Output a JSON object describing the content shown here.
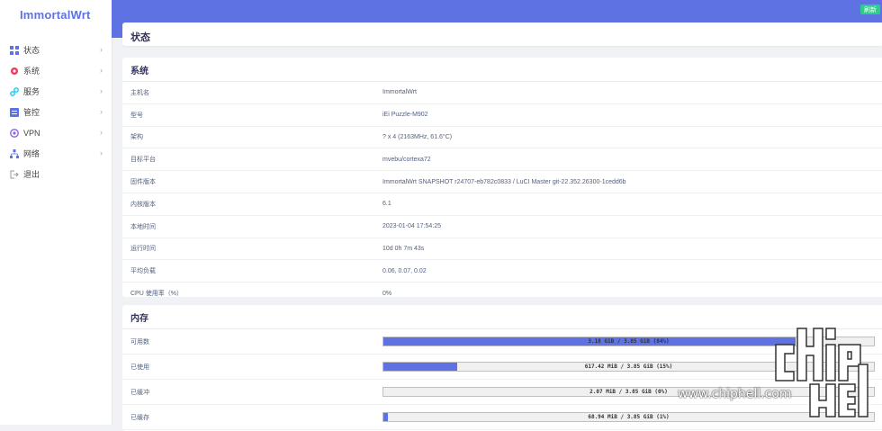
{
  "brand": "ImmortalWrt",
  "sidebar": {
    "items": [
      {
        "label": "状态",
        "icon": "dashboard-icon",
        "color": "#5e72e4",
        "chevron": true
      },
      {
        "label": "系统",
        "icon": "gear-icon",
        "color": "#f5365c",
        "chevron": true
      },
      {
        "label": "服务",
        "icon": "link-icon",
        "color": "#11cdef",
        "chevron": true
      },
      {
        "label": "管控",
        "icon": "control-icon",
        "color": "#5e72e4",
        "chevron": true
      },
      {
        "label": "VPN",
        "icon": "shield-icon",
        "color": "#8965e0",
        "chevron": true
      },
      {
        "label": "网络",
        "icon": "network-icon",
        "color": "#5e72e4",
        "chevron": true
      },
      {
        "label": "退出",
        "icon": "logout-icon",
        "color": "#999999",
        "chevron": false
      }
    ]
  },
  "topbar": {
    "refresh_label": "刷新",
    "accent": "#5e72e4",
    "refresh_color": "#2dce89"
  },
  "page": {
    "title": "状态"
  },
  "system": {
    "title": "系统",
    "rows": [
      {
        "key": "主机名",
        "value": "ImmortalWrt"
      },
      {
        "key": "型号",
        "value": "iEi Puzzle-M902"
      },
      {
        "key": "架构",
        "value": "? x 4 (2163MHz, 61.6°C)"
      },
      {
        "key": "目标平台",
        "value": "mvebu/cortexa72"
      },
      {
        "key": "固件版本",
        "value": "ImmortalWrt SNAPSHOT r24707-eb782c0833 / LuCI Master git-22.352.26300-1cedd6b"
      },
      {
        "key": "内核版本",
        "value": "6.1"
      },
      {
        "key": "本地时间",
        "value": "2023-01-04 17:54:25"
      },
      {
        "key": "运行时间",
        "value": "10d 0h 7m 43s"
      },
      {
        "key": "平均负载",
        "value": "0.06, 0.07, 0.02"
      },
      {
        "key": "CPU 使用率（%）",
        "value": "0%"
      }
    ]
  },
  "memory": {
    "title": "内存",
    "rows": [
      {
        "key": "可用数",
        "text": "3.18 GiB / 3.85 GiB (84%)",
        "fraction": 0.84
      },
      {
        "key": "已使用",
        "text": "617.42 MiB / 3.85 GiB (15%)",
        "fraction": 0.15
      },
      {
        "key": "已缓冲",
        "text": "2.07 MiB / 3.85 GiB (0%)",
        "fraction": 0.0
      },
      {
        "key": "已缓存",
        "text": "68.94 MiB / 3.85 GiB (1%)",
        "fraction": 0.01
      }
    ]
  },
  "watermark": "www.chiphell.com"
}
